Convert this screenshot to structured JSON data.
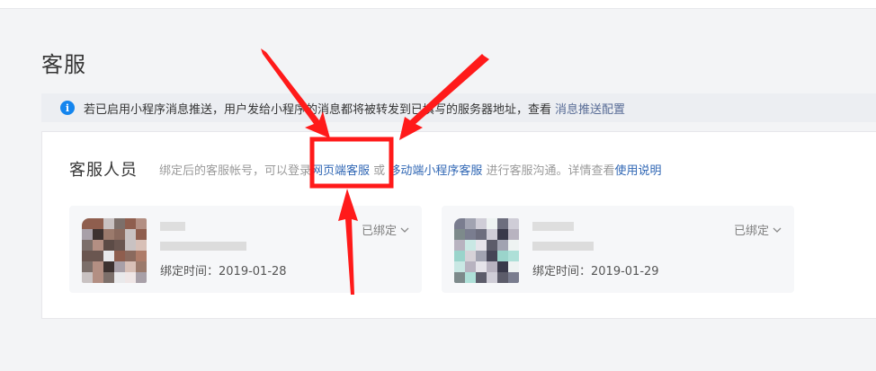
{
  "page": {
    "title": "客服"
  },
  "notice": {
    "text": "若已启用小程序消息推送，用户发给小程序的消息都将被转发到已填写的服务器地址，查看",
    "link": "消息推送配置"
  },
  "section": {
    "title": "客服人员",
    "desc_prefix": "绑定后的客服帐号，可以登录",
    "link_web": "网页端客服",
    "desc_or": "或",
    "link_mobile": "移动端小程序客服",
    "desc_mid": "进行客服沟通。详情查看",
    "link_help": "使用说明"
  },
  "cards": [
    {
      "status": "已绑定",
      "bind_time": "绑定时间：2019-01-28"
    },
    {
      "status": "已绑定",
      "bind_time": "绑定时间：2019-01-29"
    }
  ],
  "colors": {
    "accent": "#1485ee",
    "link": "#576b95",
    "annotation": "#ff1a1a"
  }
}
